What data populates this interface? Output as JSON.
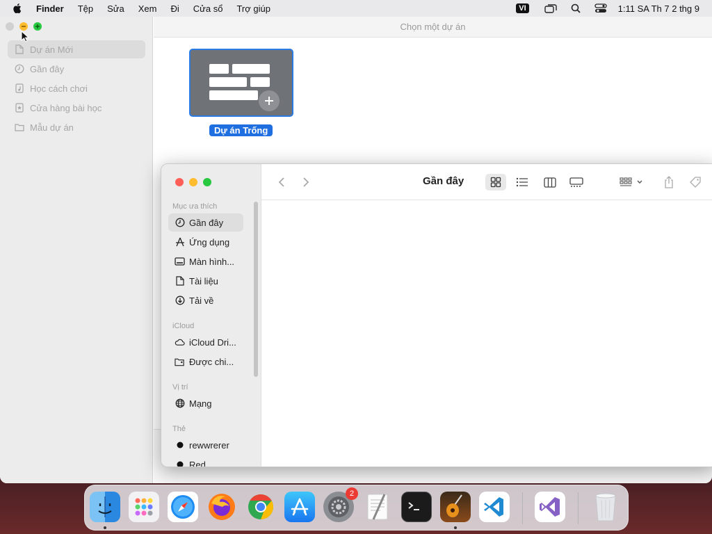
{
  "menubar": {
    "app_name": "Finder",
    "items": [
      "Tệp",
      "Sửa",
      "Xem",
      "Đi",
      "Cửa sổ",
      "Trợ giúp"
    ],
    "input_source": "VI",
    "clock": "1:11 SA Th 7 2 thg 9"
  },
  "chooser": {
    "title": "Chọn một dự án",
    "sidebar": [
      {
        "label": "Dự án Mới",
        "icon": "document-icon",
        "selected": true
      },
      {
        "label": "Gần đây",
        "icon": "clock-icon"
      },
      {
        "label": "Học cách chơi",
        "icon": "music-note-icon"
      },
      {
        "label": "Cửa hàng bài học",
        "icon": "star-icon"
      },
      {
        "label": "Mẫu dự án",
        "icon": "folder-icon"
      }
    ],
    "template": {
      "label": "Dự án Trống"
    }
  },
  "finder": {
    "title": "Gần đây",
    "sections": {
      "favorites": "Mục ưa thích",
      "icloud": "iCloud",
      "locations": "Vị trí",
      "tags": "Thẻ"
    },
    "favorites": [
      {
        "label": "Gần đây",
        "icon": "clock-icon",
        "selected": true
      },
      {
        "label": "Ứng dụng",
        "icon": "apps-icon"
      },
      {
        "label": "Màn hình...",
        "icon": "desktop-icon"
      },
      {
        "label": "Tài liệu",
        "icon": "document-icon"
      },
      {
        "label": "Tải về",
        "icon": "download-icon"
      }
    ],
    "icloud": [
      {
        "label": "iCloud Dri...",
        "icon": "cloud-icon"
      },
      {
        "label": "Được chi...",
        "icon": "shared-folder-icon"
      }
    ],
    "locations": [
      {
        "label": "Mạng",
        "icon": "globe-icon"
      }
    ],
    "tags": [
      {
        "label": "rewwrerer",
        "color": "#111111"
      },
      {
        "label": "Red",
        "color": "#111111"
      }
    ]
  },
  "dock": {
    "apps": [
      "Finder",
      "Launchpad",
      "Safari",
      "Firefox",
      "Chrome",
      "App Store",
      "System Preferences",
      "TextEdit",
      "Terminal",
      "GarageBand",
      "Visual Studio Code",
      "Visual Studio",
      "Trash"
    ],
    "settings_badge": "2"
  },
  "colors": {
    "accent": "#1f6fe0",
    "close": "#ff5f57",
    "minimize": "#febc2e",
    "zoom": "#28c840"
  }
}
